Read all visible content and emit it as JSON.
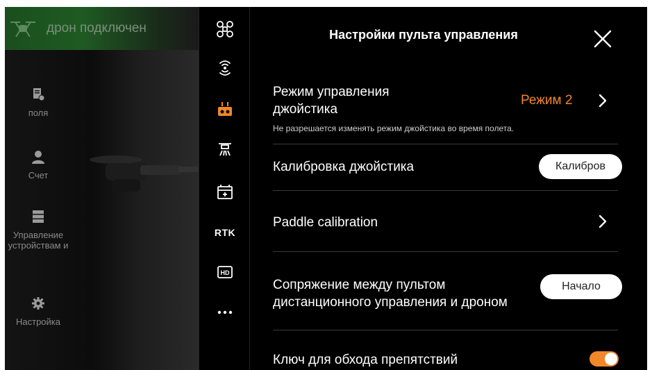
{
  "status": {
    "text": "дрон подключен"
  },
  "sidebar": {
    "items": [
      {
        "label": "поля",
        "icon": "field-doc-icon"
      },
      {
        "label": "Счет",
        "icon": "user-icon"
      },
      {
        "label": "Управление устройствам и",
        "icon": "server-icon"
      },
      {
        "label": "Настройка",
        "icon": "gear-icon"
      }
    ]
  },
  "tabs": [
    {
      "name": "drone-tab",
      "icon": "drone-icon"
    },
    {
      "name": "signal-tab",
      "icon": "signal-icon"
    },
    {
      "name": "remote-controller-tab",
      "icon": "remote-controller-icon",
      "active": true
    },
    {
      "name": "spray-tab",
      "icon": "spray-icon"
    },
    {
      "name": "battery-tab",
      "icon": "battery-icon"
    },
    {
      "name": "rtk-tab",
      "label": "RTK"
    },
    {
      "name": "hd-tab",
      "label": "HD"
    },
    {
      "name": "more-tab",
      "icon": "more-icon"
    }
  ],
  "settings": {
    "title": "Настройки пульта управления",
    "joystick_mode": {
      "label": "Режим управления джойстика",
      "value": "Режим 2",
      "note": "Не разрешается изменять режим джойстика во время полета."
    },
    "calibration": {
      "label": "Калибровка джойстика",
      "button": "Калибров"
    },
    "paddle": {
      "label": "Paddle calibration"
    },
    "pairing": {
      "label": "Сопряжение между пультом дистанционного управления и дроном",
      "button": "Начало"
    },
    "obstacle_key": {
      "label": "Ключ для обхода препятствий",
      "enabled": true
    }
  },
  "colors": {
    "accent": "#f0872a",
    "status_green": "#1f5a22"
  }
}
